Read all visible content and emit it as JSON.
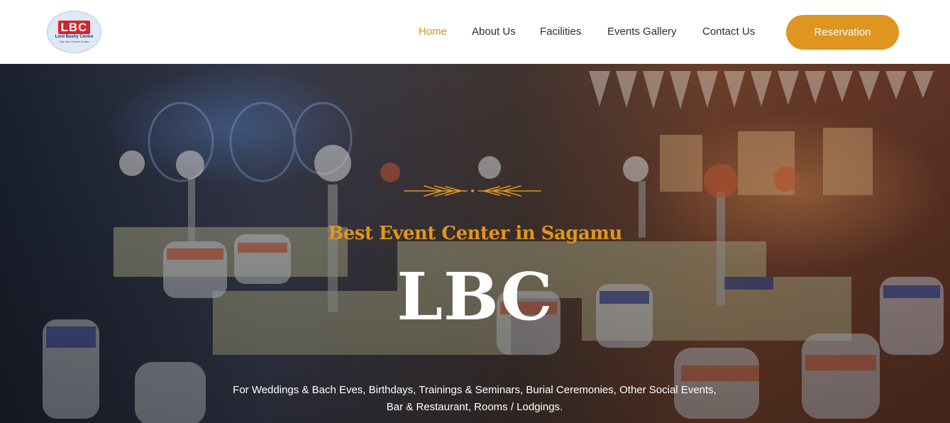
{
  "logo": {
    "mark": "LBC",
    "name": "Lord Bashy Centre",
    "tagline": "Your No.1 Event Centre"
  },
  "nav": {
    "items": [
      {
        "label": "Home",
        "active": true
      },
      {
        "label": "About Us",
        "active": false
      },
      {
        "label": "Facilities",
        "active": false
      },
      {
        "label": "Events Gallery",
        "active": false
      },
      {
        "label": "Contact Us",
        "active": false
      }
    ],
    "cta_label": "Reservation"
  },
  "hero": {
    "eyebrow": "Best Event Center in Sagamu",
    "title": "LBC",
    "description": "For Weddings & Bach Eves, Birthdays, Trainings & Seminars, Burial Ceremonies, Other Social Events, Bar & Restaurant, Rooms / Lodgings.",
    "ornament_icon": "decorative-arrows-icon"
  },
  "colors": {
    "accent": "#df9520",
    "active_nav": "#d98e1d",
    "eyebrow": "#e0961e",
    "text_dark": "#2e2e2e",
    "logo_red": "#d8222a",
    "logo_navy": "#1f2f6e"
  }
}
